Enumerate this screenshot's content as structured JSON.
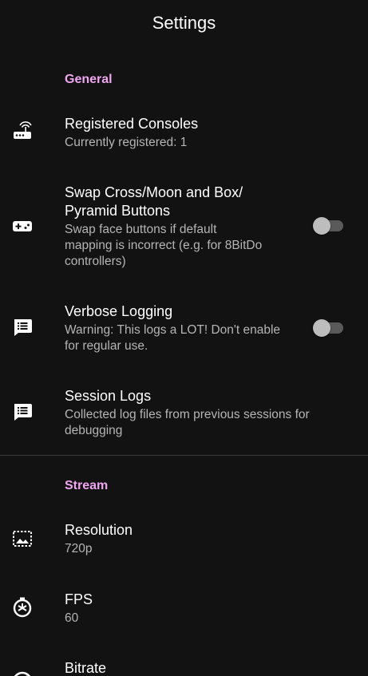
{
  "header": {
    "title": "Settings"
  },
  "sections": [
    {
      "header": "General",
      "items": [
        {
          "title": "Registered Consoles",
          "summary": "Currently registered: 1",
          "icon": "router-icon"
        },
        {
          "title_line1": "Swap Cross/Moon and Box/",
          "title_line2": "Pyramid Buttons",
          "summary_line1": "Swap face buttons if default",
          "summary_line2": "mapping is incorrect (e.g. for 8BitDo",
          "summary_line3": "controllers)",
          "icon": "gamepad-icon",
          "toggle_on": false
        },
        {
          "title": "Verbose Logging",
          "summary_line1": "Warning: This logs a LOT! Don't enable",
          "summary_line2": "for regular use.",
          "icon": "log-message-icon",
          "toggle_on": false
        },
        {
          "title": "Session Logs",
          "summary_line1": "Collected log files from previous sessions for",
          "summary_line2": "debugging",
          "icon": "log-message-icon"
        }
      ]
    },
    {
      "header": "Stream",
      "items": [
        {
          "title": "Resolution",
          "summary": "720p",
          "icon": "image-aspect-icon"
        },
        {
          "title": "FPS",
          "summary": "60",
          "icon": "timer-icon"
        },
        {
          "title": "Bitrate",
          "icon": "speedometer-icon"
        }
      ]
    }
  ],
  "colors": {
    "background": "#121212",
    "accent": "#f0a6f0",
    "summary": "#b5b5b5"
  }
}
